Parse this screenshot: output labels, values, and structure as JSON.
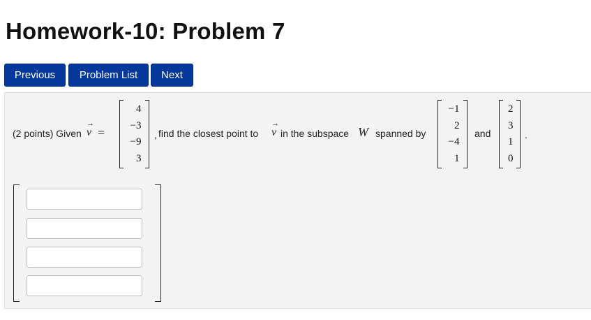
{
  "page": {
    "title": "Homework-10: Problem 7"
  },
  "nav": {
    "previous_label": "Previous",
    "problem_list_label": "Problem List",
    "next_label": "Next",
    "button_color": "#04389a"
  },
  "problem": {
    "prefix": "(2 points) Given",
    "vector_symbol": "v",
    "equals": "=",
    "v_entries": [
      "4",
      "−3",
      "−9",
      "3"
    ],
    "mid_text_comma": ",",
    "mid_text": "find the closest point to",
    "mid_text_2": "in the subspace",
    "subspace_symbol": "W",
    "spanned_by": "spanned by",
    "basis1_entries": [
      "−1",
      "2",
      "−4",
      "1"
    ],
    "and_text": "and",
    "basis2_entries": [
      "2",
      "3",
      "1",
      "0"
    ],
    "end_period": "."
  },
  "answer": {
    "inputs": [
      {
        "value": ""
      },
      {
        "value": ""
      },
      {
        "value": ""
      },
      {
        "value": ""
      }
    ]
  }
}
